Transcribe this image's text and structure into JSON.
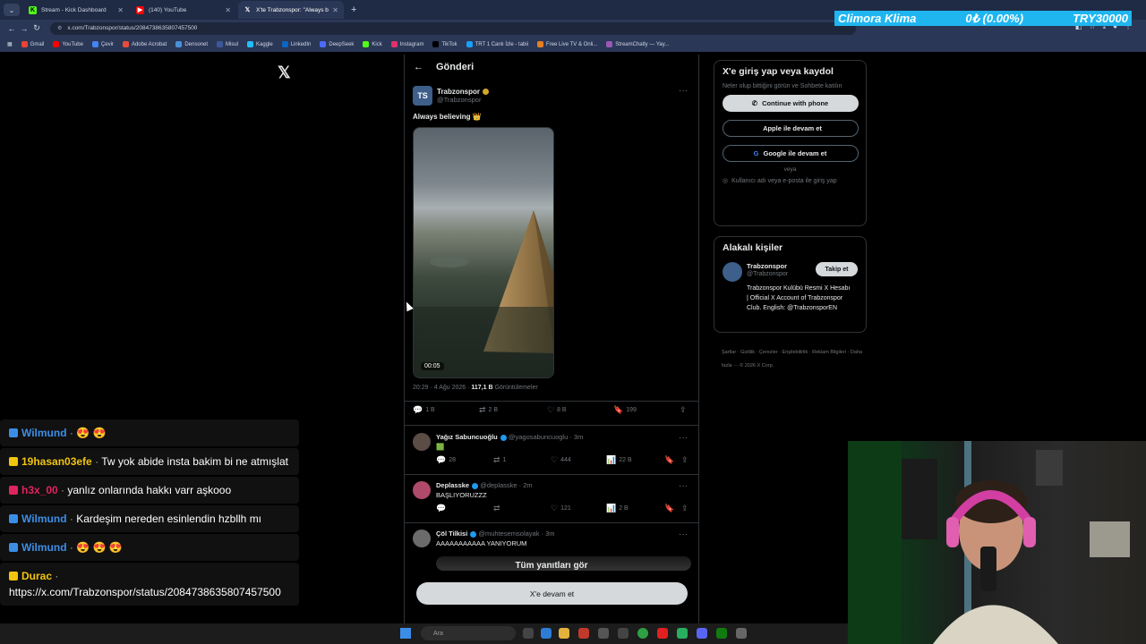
{
  "browser": {
    "tabs": [
      {
        "label": "Stream - Kick Dashboard",
        "icon": "kick-icon",
        "color": "#53fc18",
        "active": false
      },
      {
        "label": "(140) YouTube",
        "icon": "youtube-icon",
        "color": "#ff0000",
        "active": false
      },
      {
        "label": "X'te Trabzonspor: \"Always beli...",
        "icon": "x-icon",
        "color": "#ffffff",
        "active": true
      }
    ],
    "url": "x.com/Trabzonspor/status/2084738635807457500",
    "bookmarks": [
      "Gmail",
      "YouTube",
      "Çevir",
      "Adobe Acrobat",
      "Densonet",
      "Misul",
      "Kaggle",
      "LinkedIn",
      "DeepSeek",
      "Kick",
      "Instagram",
      "TikTok",
      "TRT 1 Canlı İzle - tabii",
      "Free Live TV & Onli...",
      "StreamChatly — Yay..."
    ]
  },
  "ticker": {
    "label": "Climora Klima",
    "change": "0₺ (0.00%)",
    "goal": "TRY30000"
  },
  "header": {
    "title": "Gönderi"
  },
  "post": {
    "author": "Trabzonspor",
    "handle": "@Trabzonspor",
    "text": "Always believing 👑",
    "duration": "00:05",
    "time": "20:29 · 4 Ağu 2026 · ",
    "views": "117,1 B",
    "views_label": " Görüntülemeler",
    "stats": {
      "replies": "1 B",
      "reposts": "2 B",
      "likes": "8 B",
      "bookmarks": "199"
    }
  },
  "replies": [
    {
      "name": "Yağız Sabuncuoğlu",
      "handle": "@yagosabuncuoglu · 3m",
      "text": "🟩",
      "replies": "28",
      "reposts": "1",
      "likes": "444",
      "views": "22 B"
    },
    {
      "name": "Deplasske",
      "handle": "@deplasske · 2m",
      "text": "BAŞLIYORUZZZ",
      "replies": "",
      "reposts": "",
      "likes": "121",
      "views": "2 B"
    },
    {
      "name": "Çöl Tilkisi",
      "handle": "@muhtesemsolayak · 3m",
      "text": "AAAAAAAAAAA YANIYORUM"
    }
  ],
  "all_replies_label": "Tüm yanıtları gör",
  "continue_label": "X'e devam et",
  "signup": {
    "title": "X'e giriş yap veya kaydol",
    "subtitle": "Neler olup bittiğini görün ve Sohbete katılın",
    "phone": "Continue with phone",
    "apple": "Apple ile devam et",
    "google": "Google ile devam et",
    "or": "veya",
    "login": "Kullanıcı adı veya e-posta ile giriş yap"
  },
  "related": {
    "title": "Alakalı kişiler",
    "name": "Trabzonspor",
    "handle": "@Trabzonspor",
    "bio": "Trabzonspor Kulübü Resmi X Hesabı | Official X Account of Trabzonspor Club. English: @TrabzonsporEN",
    "follow": "Takip et"
  },
  "footer": "Şartlar · Gizlilik · Çerezler · Erişilebilirlik · Reklam Bilgileri · Daha fazla ··· © 2026 X Corp.",
  "chat": [
    {
      "user": "Wilmund",
      "color": "#3b8ee6",
      "text": "😍 😍"
    },
    {
      "user": "19hasan03efe",
      "color": "#f1c40f",
      "text": "Tw yok abide insta bakim bi ne atmışlat"
    },
    {
      "user": "h3x_00",
      "color": "#e0245e",
      "text": "yanlız onlarında hakkı varr aşkooo"
    },
    {
      "user": "Wilmund",
      "color": "#3b8ee6",
      "text": "Kardeşim nereden esinlendin hzbllh mı"
    },
    {
      "user": "Wilmund",
      "color": "#3b8ee6",
      "text": "😍 😍 😍"
    },
    {
      "user": "Durac",
      "color": "#f1c40f",
      "text": "https://x.com/Trabzonspor/status/2084738635807457500"
    }
  ],
  "taskbar": {
    "search": "Ara"
  }
}
